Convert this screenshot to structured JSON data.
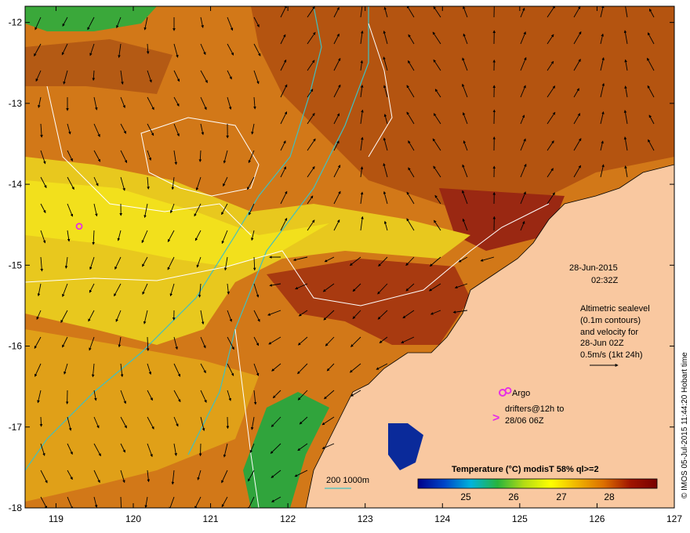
{
  "map": {
    "lon_ticks": [
      "119",
      "120",
      "121",
      "122",
      "123",
      "124",
      "125",
      "126",
      "127"
    ],
    "lat_ticks": [
      "-12",
      "-13",
      "-14",
      "-15",
      "-16",
      "-17",
      "-18"
    ],
    "date": "28-Jun-2015",
    "time": "02:32Z",
    "legend_lines": [
      "Altimetric sealevel",
      "(0.1m contours)",
      "and velocity for",
      "28-Jun 02Z",
      "0.5m/s (1kt 24h)"
    ],
    "argo_label": "Argo",
    "drifters_lines": [
      "drifters@12h to",
      "28/06 06Z"
    ],
    "isobath_label": "200  1000m",
    "colorbar_title": "Temperature  (°C) modisT 58% ql>=2",
    "colorbar_ticks": [
      "25",
      "26",
      "27",
      "28"
    ],
    "stamp": "© IMOS 05-Jul-2015 11:44:20 Hobart time",
    "colors": {
      "land": "#f9c8a0",
      "warm": "#c86414",
      "hot": "#8b1a0a",
      "cool": "#e8d21a",
      "cold_green": "#2ea83a",
      "argo": "#e62ee6",
      "isobath": "#40c0c0"
    },
    "colorbar_stops": [
      "#00008b",
      "#0046c8",
      "#00b4dc",
      "#28b43c",
      "#b4dc14",
      "#ffff00",
      "#f0b400",
      "#dc6e00",
      "#a01400",
      "#780000"
    ],
    "argo_markers": [
      [
        119.3,
        -14.52
      ],
      [
        124.85,
        -16.55
      ]
    ]
  }
}
